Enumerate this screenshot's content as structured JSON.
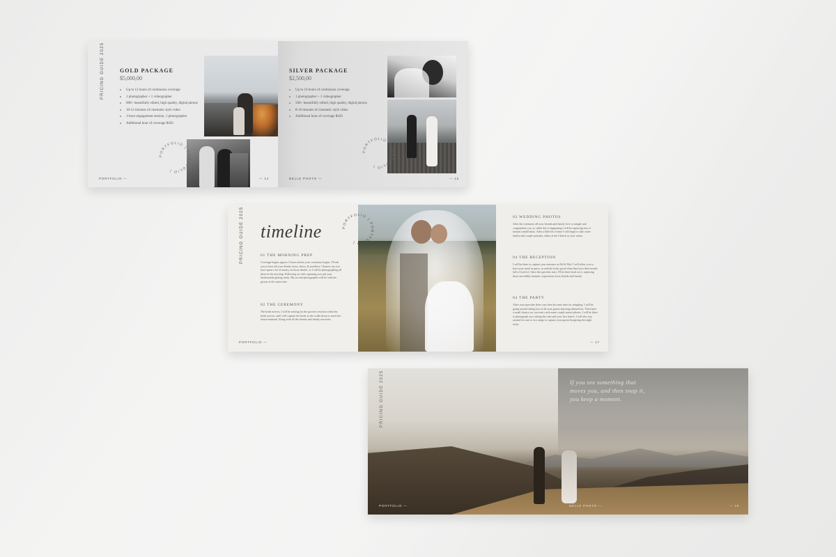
{
  "spread1": {
    "vertical_label": "PRICING GUIDE 2025",
    "left": {
      "package": "GOLD PACKAGE",
      "price": "$5,000,00",
      "features": [
        "Up to 12 hours of continuous coverage",
        "1 photographer + 1 videographer",
        "600+ beautifully edited, high quality, digital photos",
        "10-12 minutes of cinematic style video",
        "1-hour engagement session, 1 photographer",
        "Additional hour of coverage $450"
      ],
      "footer": "PORTFOLIO —",
      "page_no": "— 14"
    },
    "right": {
      "package": "SILVER PACKAGE",
      "price": "$2,500,00",
      "features": [
        "Up to 10 hours of continuous coverage",
        "1 photographer + 1 videographer",
        "500+ beautifully edited, high quality, digital photos",
        "8-10 minutes of cinematic style video",
        "Additional hour of coverage $450"
      ],
      "footer": "BELLE PHOTO —",
      "page_no": "— 15"
    },
    "stamp_text": "PORTFOLIO | PORTFOLIO | "
  },
  "spread2": {
    "vertical_label": "PRICING GUIDE 2025",
    "title": "timeline",
    "stamp_text": "PORTFOLIO | PORTFOLIO | ",
    "sections_left": [
      {
        "title": "01 THE MORNING PREP",
        "body": "Coverage begins approx 2 hours before your ceremony begins. I'll ask you to have all your details, dress, shoes, & jewellery. Chances are you have spent a lot of money on those details, so I will be photographing all these in the morning. Following on with capturing you and your bridesmaids getting ready. My second photographer will be with the groom at the same time."
      },
      {
        "title": "02 THE CEREMONY",
        "body": "The bride arrives, I will be waiting for the groom's reaction when the bride arrives, and I will capture the bride as she walks down to meet her future husband. Along with all the friends and family reactions."
      }
    ],
    "sections_right": [
      {
        "title": "03 WEDDING PHOTOS",
        "body": "After the ceremony all your friends and family love to mingle and congratulate you, so while this is happening I will be capturing lots of natural candid shots. After a little bit of time I will begin to take some family and couple portraits, either at the Church or your venue."
      },
      {
        "title": "04 THE RECEPTION",
        "body": "I will be there to capture your entrance as Mr & Mrs! I will allow you to have your meal in peace, as nobody looks good when they have their mouth full of food lol. Once the speeches start, I'll be there back on it, capturing those incredibly fantastic expressions from friends and family."
      },
      {
        "title": "04 THE PARTY",
        "body": "After your speeches there can often be some time for mingling. I will be going around taking lots of all your guests enjoying themselves. Then have a small chance we can even catch some couple sunset photos. I will be there to photograph you cutting the cake and your first dance. I will also stay around for one or two songs to capture your guests boogieing the night away."
      }
    ],
    "footer": "PORTFOLIO —",
    "page_no": "— 17"
  },
  "spread3": {
    "vertical_label": "PRICING GUIDE 2025",
    "quote": [
      "If you see something that",
      "moves you, and then snap it,",
      "you keep a moment."
    ],
    "footer_left": "PORTFOLIO —",
    "footer_mid": "BELLE PHOTO —",
    "page_no": "— 19"
  }
}
